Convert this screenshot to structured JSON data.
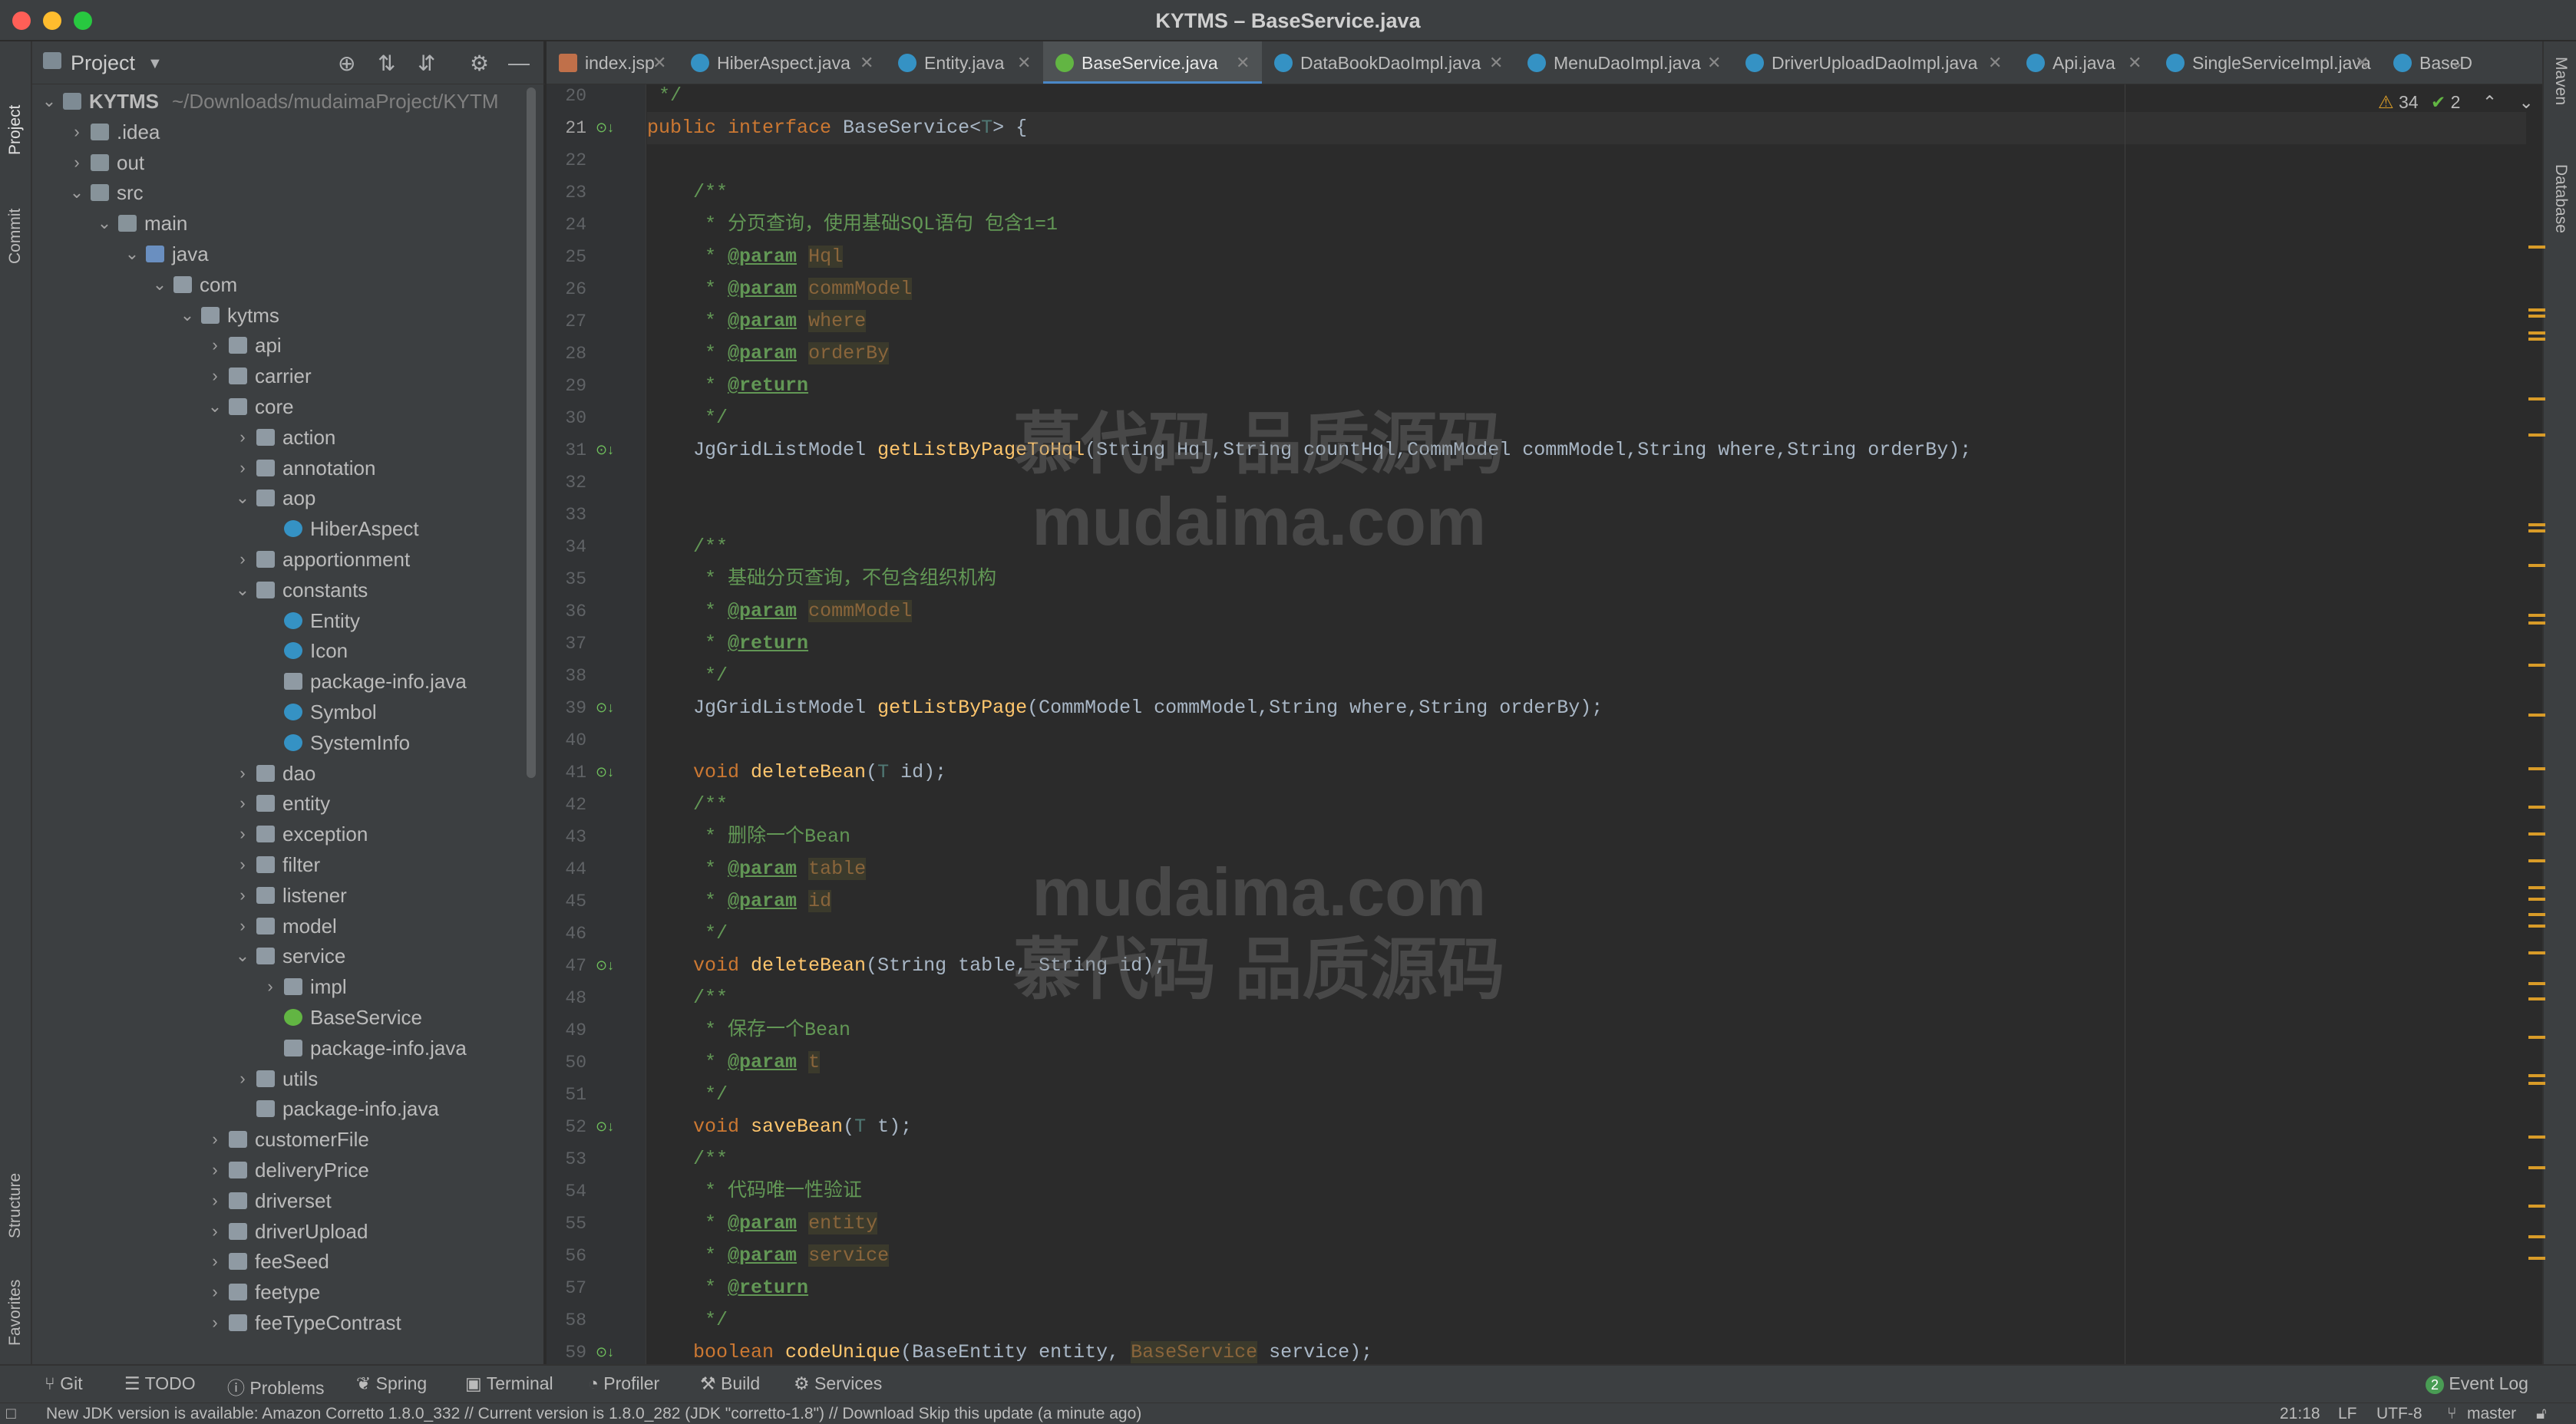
{
  "window": {
    "title": "KYTMS – BaseService.java"
  },
  "left_strip": {
    "project": "Project",
    "commit": "Commit",
    "structure": "Structure",
    "favorites": "Favorites"
  },
  "right_strip": {
    "maven": "Maven",
    "database": "Database"
  },
  "project_panel": {
    "title": "Project",
    "tree": [
      {
        "depth": 0,
        "open": true,
        "icon": "proj",
        "label": "KYTMS",
        "path": "~/Downloads/mudaimaProject/KYTM"
      },
      {
        "depth": 1,
        "open": false,
        "icon": "folder",
        "label": ".idea"
      },
      {
        "depth": 1,
        "open": false,
        "icon": "folder",
        "label": "out"
      },
      {
        "depth": 1,
        "open": true,
        "icon": "folder",
        "label": "src"
      },
      {
        "depth": 2,
        "open": true,
        "icon": "folder",
        "label": "main"
      },
      {
        "depth": 3,
        "open": true,
        "icon": "src",
        "label": "java"
      },
      {
        "depth": 4,
        "open": true,
        "icon": "pkg",
        "label": "com"
      },
      {
        "depth": 5,
        "open": true,
        "icon": "pkg",
        "label": "kytms"
      },
      {
        "depth": 6,
        "open": false,
        "icon": "pkg",
        "label": "api"
      },
      {
        "depth": 6,
        "open": false,
        "icon": "pkg",
        "label": "carrier"
      },
      {
        "depth": 6,
        "open": true,
        "icon": "pkg",
        "label": "core"
      },
      {
        "depth": 7,
        "open": false,
        "icon": "pkg",
        "label": "action"
      },
      {
        "depth": 7,
        "open": false,
        "icon": "pkg",
        "label": "annotation"
      },
      {
        "depth": 7,
        "open": true,
        "icon": "pkg",
        "label": "aop"
      },
      {
        "depth": 8,
        "leaf": true,
        "icon": "class",
        "label": "HiberAspect"
      },
      {
        "depth": 7,
        "open": false,
        "icon": "pkg",
        "label": "apportionment"
      },
      {
        "depth": 7,
        "open": true,
        "icon": "pkg",
        "label": "constants"
      },
      {
        "depth": 8,
        "leaf": true,
        "icon": "class",
        "label": "Entity"
      },
      {
        "depth": 8,
        "leaf": true,
        "icon": "class",
        "label": "Icon"
      },
      {
        "depth": 8,
        "leaf": true,
        "icon": "file",
        "label": "package-info.java"
      },
      {
        "depth": 8,
        "leaf": true,
        "icon": "class",
        "label": "Symbol"
      },
      {
        "depth": 8,
        "leaf": true,
        "icon": "class",
        "label": "SystemInfo"
      },
      {
        "depth": 7,
        "open": false,
        "icon": "pkg",
        "label": "dao"
      },
      {
        "depth": 7,
        "open": false,
        "icon": "pkg",
        "label": "entity"
      },
      {
        "depth": 7,
        "open": false,
        "icon": "pkg",
        "label": "exception"
      },
      {
        "depth": 7,
        "open": false,
        "icon": "pkg",
        "label": "filter"
      },
      {
        "depth": 7,
        "open": false,
        "icon": "pkg",
        "label": "listener"
      },
      {
        "depth": 7,
        "open": false,
        "icon": "pkg",
        "label": "model"
      },
      {
        "depth": 7,
        "open": true,
        "icon": "pkg",
        "label": "service"
      },
      {
        "depth": 8,
        "open": false,
        "icon": "pkg",
        "label": "impl"
      },
      {
        "depth": 8,
        "leaf": true,
        "icon": "iface",
        "label": "BaseService"
      },
      {
        "depth": 8,
        "leaf": true,
        "icon": "file",
        "label": "package-info.java"
      },
      {
        "depth": 7,
        "open": false,
        "icon": "pkg",
        "label": "utils"
      },
      {
        "depth": 7,
        "leaf": true,
        "icon": "file",
        "label": "package-info.java"
      },
      {
        "depth": 6,
        "open": false,
        "icon": "pkg",
        "label": "customerFile"
      },
      {
        "depth": 6,
        "open": false,
        "icon": "pkg",
        "label": "deliveryPrice"
      },
      {
        "depth": 6,
        "open": false,
        "icon": "pkg",
        "label": "driverset"
      },
      {
        "depth": 6,
        "open": false,
        "icon": "pkg",
        "label": "driverUpload"
      },
      {
        "depth": 6,
        "open": false,
        "icon": "pkg",
        "label": "feeSeed"
      },
      {
        "depth": 6,
        "open": false,
        "icon": "pkg",
        "label": "feetype"
      },
      {
        "depth": 6,
        "open": false,
        "icon": "pkg",
        "label": "feeTypeContrast"
      }
    ]
  },
  "tabs": [
    {
      "label": "index.jsp",
      "active": false
    },
    {
      "label": "HiberAspect.java",
      "active": false
    },
    {
      "label": "Entity.java",
      "active": false
    },
    {
      "label": "BaseService.java",
      "active": true
    },
    {
      "label": "DataBookDaoImpl.java",
      "active": false
    },
    {
      "label": "MenuDaoImpl.java",
      "active": false
    },
    {
      "label": "DriverUploadDaoImpl.java",
      "active": false
    },
    {
      "label": "Api.java",
      "active": false
    },
    {
      "label": "SingleServiceImpl.java",
      "active": false
    },
    {
      "label": "BaseD",
      "active": false
    }
  ],
  "inspection": {
    "warnings": "34",
    "ok": "2"
  },
  "editor": {
    "first_line": 20,
    "current_line": 21,
    "lines": [
      [
        [
          "cm",
          " */"
        ]
      ],
      [
        [
          "kw",
          "public interface "
        ],
        [
          "",
          "BaseService<"
        ],
        [
          "gen",
          "T"
        ],
        [
          "",
          "> {"
        ]
      ],
      [],
      [
        [
          "cm",
          "    /**"
        ]
      ],
      [
        [
          "cm",
          "     * 分页查询，使用基础SQL语句 包含1=1"
        ]
      ],
      [
        [
          "cm",
          "     * "
        ],
        [
          "tg",
          "@param"
        ],
        [
          "cm",
          " "
        ],
        [
          "pv",
          "Hql"
        ]
      ],
      [
        [
          "cm",
          "     * "
        ],
        [
          "tg",
          "@param"
        ],
        [
          "cm",
          " "
        ],
        [
          "pv",
          "commModel"
        ]
      ],
      [
        [
          "cm",
          "     * "
        ],
        [
          "tg",
          "@param"
        ],
        [
          "cm",
          " "
        ],
        [
          "pv",
          "where"
        ]
      ],
      [
        [
          "cm",
          "     * "
        ],
        [
          "tg",
          "@param"
        ],
        [
          "cm",
          " "
        ],
        [
          "pv",
          "orderBy"
        ]
      ],
      [
        [
          "cm",
          "     * "
        ],
        [
          "tg",
          "@return"
        ]
      ],
      [
        [
          "cm",
          "     */"
        ]
      ],
      [
        [
          "",
          "    JgGridListModel "
        ],
        [
          "fn",
          "getListByPageToHql"
        ],
        [
          "",
          "(String Hql,String countHql,CommModel commModel,String where,String orderBy);"
        ]
      ],
      [],
      [],
      [
        [
          "cm",
          "    /**"
        ]
      ],
      [
        [
          "cm",
          "     * 基础分页查询，不包含组织机构"
        ]
      ],
      [
        [
          "cm",
          "     * "
        ],
        [
          "tg",
          "@param"
        ],
        [
          "cm",
          " "
        ],
        [
          "pv",
          "commModel"
        ]
      ],
      [
        [
          "cm",
          "     * "
        ],
        [
          "tg",
          "@return"
        ]
      ],
      [
        [
          "cm",
          "     */"
        ]
      ],
      [
        [
          "",
          "    JgGridListModel "
        ],
        [
          "fn",
          "getListByPage"
        ],
        [
          "",
          "(CommModel commModel,String where,String orderBy);"
        ]
      ],
      [],
      [
        [
          "kw",
          "    void "
        ],
        [
          "fn",
          "deleteBean"
        ],
        [
          "",
          "("
        ],
        [
          "gen",
          "T"
        ],
        [
          "",
          " id);"
        ]
      ],
      [
        [
          "cm",
          "    /**"
        ]
      ],
      [
        [
          "cm",
          "     * 删除一个Bean"
        ]
      ],
      [
        [
          "cm",
          "     * "
        ],
        [
          "tg",
          "@param"
        ],
        [
          "cm",
          " "
        ],
        [
          "pv",
          "table"
        ]
      ],
      [
        [
          "cm",
          "     * "
        ],
        [
          "tg",
          "@param"
        ],
        [
          "cm",
          " "
        ],
        [
          "pv",
          "id"
        ]
      ],
      [
        [
          "cm",
          "     */"
        ]
      ],
      [
        [
          "kw",
          "    void "
        ],
        [
          "fn",
          "deleteBean"
        ],
        [
          "",
          "(String table, String id);"
        ]
      ],
      [
        [
          "cm",
          "    /**"
        ]
      ],
      [
        [
          "cm",
          "     * 保存一个Bean"
        ]
      ],
      [
        [
          "cm",
          "     * "
        ],
        [
          "tg",
          "@param"
        ],
        [
          "cm",
          " "
        ],
        [
          "pv",
          "t"
        ]
      ],
      [
        [
          "cm",
          "     */"
        ]
      ],
      [
        [
          "kw",
          "    void "
        ],
        [
          "fn",
          "saveBean"
        ],
        [
          "",
          "("
        ],
        [
          "gen",
          "T"
        ],
        [
          "",
          " t);"
        ]
      ],
      [
        [
          "cm",
          "    /**"
        ]
      ],
      [
        [
          "cm",
          "     * 代码唯一性验证"
        ]
      ],
      [
        [
          "cm",
          "     * "
        ],
        [
          "tg",
          "@param"
        ],
        [
          "cm",
          " "
        ],
        [
          "pv",
          "entity"
        ]
      ],
      [
        [
          "cm",
          "     * "
        ],
        [
          "tg",
          "@param"
        ],
        [
          "cm",
          " "
        ],
        [
          "pv",
          "service"
        ]
      ],
      [
        [
          "cm",
          "     * "
        ],
        [
          "tg",
          "@return"
        ]
      ],
      [
        [
          "cm",
          "     */"
        ]
      ],
      [
        [
          "kw",
          "    boolean "
        ],
        [
          "fn",
          "codeUnique"
        ],
        [
          "",
          "(BaseEntity entity, "
        ],
        [
          "pv",
          "BaseService"
        ],
        [
          "",
          " service);"
        ]
      ]
    ],
    "gutter_icons": [
      21,
      31,
      39,
      41,
      47,
      52,
      59
    ]
  },
  "watermark": {
    "top_line1": "慕代码 品质源码",
    "top_line2": "mudaima.com",
    "bottom_line1": "mudaima.com",
    "bottom_line2": "慕代码 品质源码"
  },
  "tool_windows": {
    "git": "Git",
    "todo": "TODO",
    "problems": "Problems",
    "spring": "Spring",
    "terminal": "Terminal",
    "profiler": "Profiler",
    "build": "Build",
    "services": "Services",
    "event_log_count": "2",
    "event_log": "Event Log"
  },
  "status_bar": {
    "message": "New JDK version is available: Amazon Corretto 1.8.0_332 // Current version is 1.8.0_282 (JDK \"corretto-1.8\") // Download   Skip this update (a minute ago)",
    "position": "21:18",
    "line_sep": "LF",
    "encoding": "UTF-8",
    "branch": "master"
  },
  "colors": {
    "accent": "#4a88c7",
    "keyword": "#cc7832",
    "comment": "#629755",
    "method": "#ffc66d",
    "warning_mark": "#d89b28"
  }
}
